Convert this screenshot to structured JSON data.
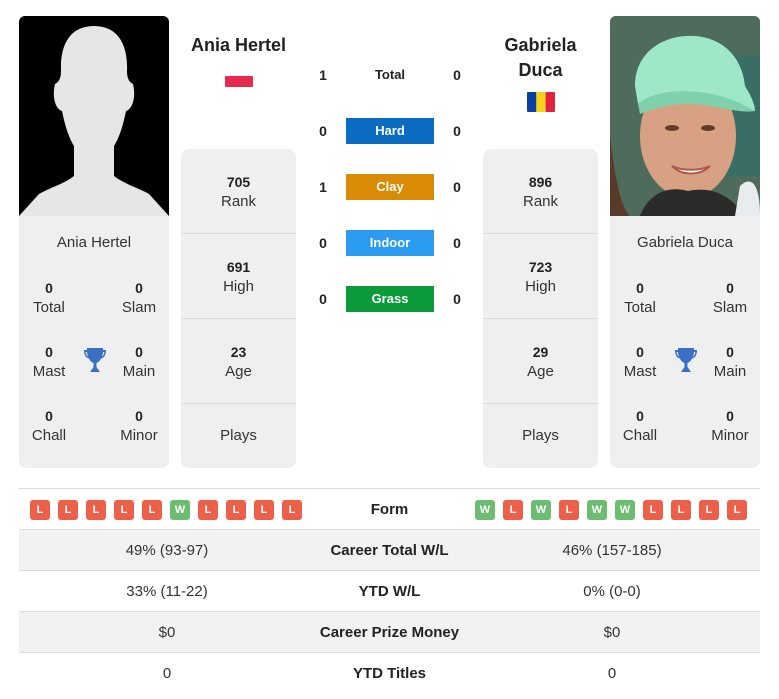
{
  "colors": {
    "hard": "#0a6cc1",
    "clay": "#d98b05",
    "indoor": "#2b9cf2",
    "grass": "#0a9a3a",
    "win": "#6cbd72",
    "loss": "#ec5f48",
    "trophy": "#3a6fc2"
  },
  "player_left": {
    "name": "Ania Hertel",
    "flag": "poland-flag",
    "photo": "silhouette-placeholder",
    "titles": {
      "total": {
        "value": "0",
        "label": "Total"
      },
      "slam": {
        "value": "0",
        "label": "Slam"
      },
      "mast": {
        "value": "0",
        "label": "Mast"
      },
      "main": {
        "value": "0",
        "label": "Main"
      },
      "chall": {
        "value": "0",
        "label": "Chall"
      },
      "minor": {
        "value": "0",
        "label": "Minor"
      }
    },
    "stats": [
      {
        "value": "705",
        "label": "Rank"
      },
      {
        "value": "691",
        "label": "High"
      },
      {
        "value": "23",
        "label": "Age"
      },
      {
        "value": "",
        "label": "Plays"
      }
    ],
    "form": [
      "L",
      "L",
      "L",
      "L",
      "L",
      "W",
      "L",
      "L",
      "L",
      "L"
    ]
  },
  "player_right": {
    "name": "Gabriela Duca",
    "name_line1": "Gabriela",
    "name_line2": "Duca",
    "flag": "romania-flag",
    "photo": "player-photo",
    "titles": {
      "total": {
        "value": "0",
        "label": "Total"
      },
      "slam": {
        "value": "0",
        "label": "Slam"
      },
      "mast": {
        "value": "0",
        "label": "Mast"
      },
      "main": {
        "value": "0",
        "label": "Main"
      },
      "chall": {
        "value": "0",
        "label": "Chall"
      },
      "minor": {
        "value": "0",
        "label": "Minor"
      }
    },
    "stats": [
      {
        "value": "896",
        "label": "Rank"
      },
      {
        "value": "723",
        "label": "High"
      },
      {
        "value": "29",
        "label": "Age"
      },
      {
        "value": "",
        "label": "Plays"
      }
    ],
    "form": [
      "W",
      "L",
      "W",
      "L",
      "W",
      "W",
      "L",
      "L",
      "L",
      "L"
    ]
  },
  "h2h": [
    {
      "label": "Total",
      "left": "1",
      "right": "0",
      "surface": "total"
    },
    {
      "label": "Hard",
      "left": "0",
      "right": "0",
      "surface": "hard"
    },
    {
      "label": "Clay",
      "left": "1",
      "right": "0",
      "surface": "clay"
    },
    {
      "label": "Indoor",
      "left": "0",
      "right": "0",
      "surface": "indoor"
    },
    {
      "label": "Grass",
      "left": "0",
      "right": "0",
      "surface": "grass"
    }
  ],
  "comparison": [
    {
      "label": "Form",
      "left": "",
      "right": ""
    },
    {
      "label": "Career Total W/L",
      "left": "49% (93-97)",
      "right": "46% (157-185)"
    },
    {
      "label": "YTD W/L",
      "left": "33% (11-22)",
      "right": "0% (0-0)"
    },
    {
      "label": "Career Prize Money",
      "left": "$0",
      "right": "$0"
    },
    {
      "label": "YTD Titles",
      "left": "0",
      "right": "0"
    }
  ]
}
